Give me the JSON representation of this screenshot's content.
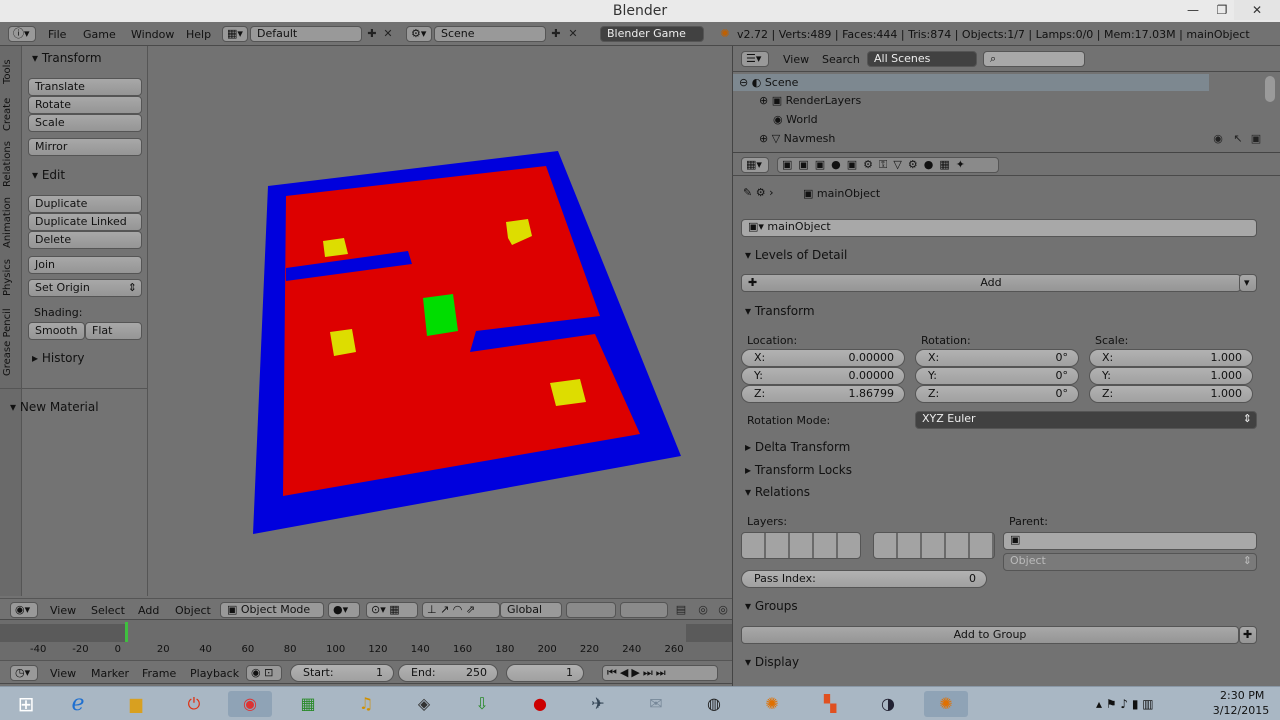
{
  "window": {
    "title": "Blender",
    "controls": [
      "—",
      "❐",
      "✕"
    ]
  },
  "info_header": {
    "menus": [
      "File",
      "Game",
      "Window",
      "Help"
    ],
    "layout": "Default",
    "scene": "Scene",
    "engine": "Blender Game",
    "stats": "v2.72 | Verts:489 | Faces:444 | Tris:874 | Objects:1/7 | Lamps:0/0 | Mem:17.03M | mainObject"
  },
  "tool_shelf": {
    "tabs": [
      "Tools",
      "Create",
      "Relations",
      "Animation",
      "Physics",
      "Grease Pencil"
    ],
    "transform_title": "Transform",
    "transform_buttons": [
      "Translate",
      "Rotate",
      "Scale"
    ],
    "mirror": "Mirror",
    "edit_title": "Edit",
    "edit_buttons": [
      "Duplicate",
      "Duplicate Linked",
      "Delete"
    ],
    "join": "Join",
    "set_origin": "Set Origin",
    "shading_label": "Shading:",
    "smooth": "Smooth",
    "flat": "Flat",
    "history": "History",
    "new_material": "New Material"
  },
  "view3d_header": {
    "menus": [
      "View",
      "Select",
      "Add",
      "Object"
    ],
    "mode": "Object Mode",
    "orientation": "Global"
  },
  "timeline": {
    "ticks": [
      "-40",
      "-20",
      "0",
      "20",
      "40",
      "60",
      "80",
      "100",
      "120",
      "140",
      "160",
      "180",
      "200",
      "220",
      "240",
      "260"
    ],
    "menus": [
      "View",
      "Marker",
      "Frame",
      "Playback"
    ],
    "start_label": "Start:",
    "start": "1",
    "end_label": "End:",
    "end": "250",
    "current": "1"
  },
  "outliner": {
    "menus": [
      "View",
      "Search"
    ],
    "filter": "All Scenes",
    "items": [
      "Scene",
      "RenderLayers",
      "World",
      "Navmesh"
    ]
  },
  "properties": {
    "breadcrumb": "mainObject",
    "object_name": "mainObject",
    "lod_title": "Levels of Detail",
    "add_button": "Add",
    "transform_title": "Transform",
    "location_label": "Location:",
    "rotation_label": "Rotation:",
    "scale_label": "Scale:",
    "location": [
      {
        "k": "X:",
        "v": "0.00000"
      },
      {
        "k": "Y:",
        "v": "0.00000"
      },
      {
        "k": "Z:",
        "v": "1.86799"
      }
    ],
    "rotation": [
      {
        "k": "X:",
        "v": "0°"
      },
      {
        "k": "Y:",
        "v": "0°"
      },
      {
        "k": "Z:",
        "v": "0°"
      }
    ],
    "scale": [
      {
        "k": "X:",
        "v": "1.000"
      },
      {
        "k": "Y:",
        "v": "1.000"
      },
      {
        "k": "Z:",
        "v": "1.000"
      }
    ],
    "rotation_mode_label": "Rotation Mode:",
    "rotation_mode": "XYZ Euler",
    "delta_transform": "Delta Transform",
    "transform_locks": "Transform Locks",
    "relations_title": "Relations",
    "layers_label": "Layers:",
    "parent_label": "Parent:",
    "parent_type": "Object",
    "pass_index_label": "Pass Index:",
    "pass_index": "0",
    "groups_title": "Groups",
    "add_to_group": "Add to Group",
    "display_title": "Display"
  },
  "taskbar": {
    "time": "2:30 PM",
    "date": "3/12/2015"
  },
  "colors": {
    "floor": "#dd0000",
    "walls": "#0000dd",
    "player": "#00dd00",
    "pickups": "#dddd00"
  }
}
